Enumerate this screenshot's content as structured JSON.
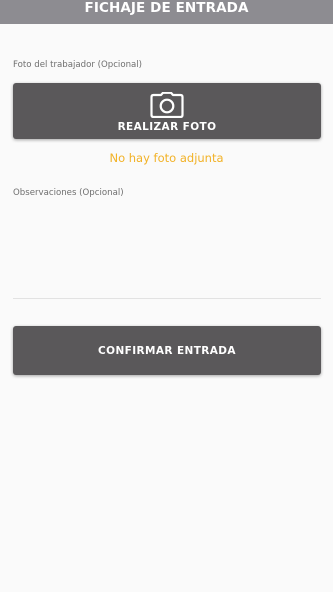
{
  "header": {
    "title": "FICHAJE DE ENTRADA"
  },
  "photo": {
    "label": "Foto del trabajador (Opcional)",
    "button_label": "REALIZAR FOTO",
    "icon": "camera-icon",
    "status_text": "No hay foto adjunta"
  },
  "observations": {
    "label": "Observaciones (Opcional)",
    "value": ""
  },
  "confirm": {
    "button_label": "CONFIRMAR ENTRADA"
  },
  "colors": {
    "header_bg": "#8d8c91",
    "button_bg": "#5a585a",
    "status_text": "#f2b227",
    "background": "#fafafa"
  }
}
